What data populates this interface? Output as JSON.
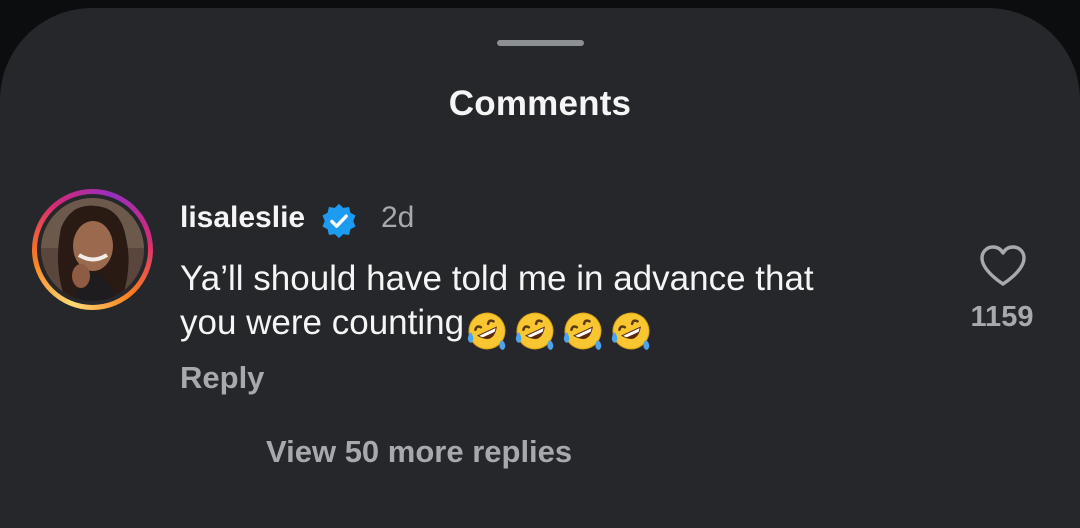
{
  "sheet": {
    "title": "Comments"
  },
  "comment": {
    "username": "lisaleslie",
    "verified": true,
    "time": "2d",
    "text_line1": "Ya’ll should have told me in advance that",
    "text_line2": "you were counting",
    "emojis": [
      "🤣",
      "🤣",
      "🤣",
      "🤣"
    ],
    "reply_label": "Reply",
    "like_count": "1159",
    "view_more_label": "View 50 more replies"
  },
  "colors": {
    "sheet_background": "#25272b",
    "primary_text": "#f5f5f5",
    "secondary_text": "#a6a9ae",
    "verified_badge": "#1d9bf0"
  },
  "icons": {
    "verified": "verified-badge-icon",
    "like": "heart-icon",
    "emoji": "rolling-on-floor-laughing-emoji"
  }
}
